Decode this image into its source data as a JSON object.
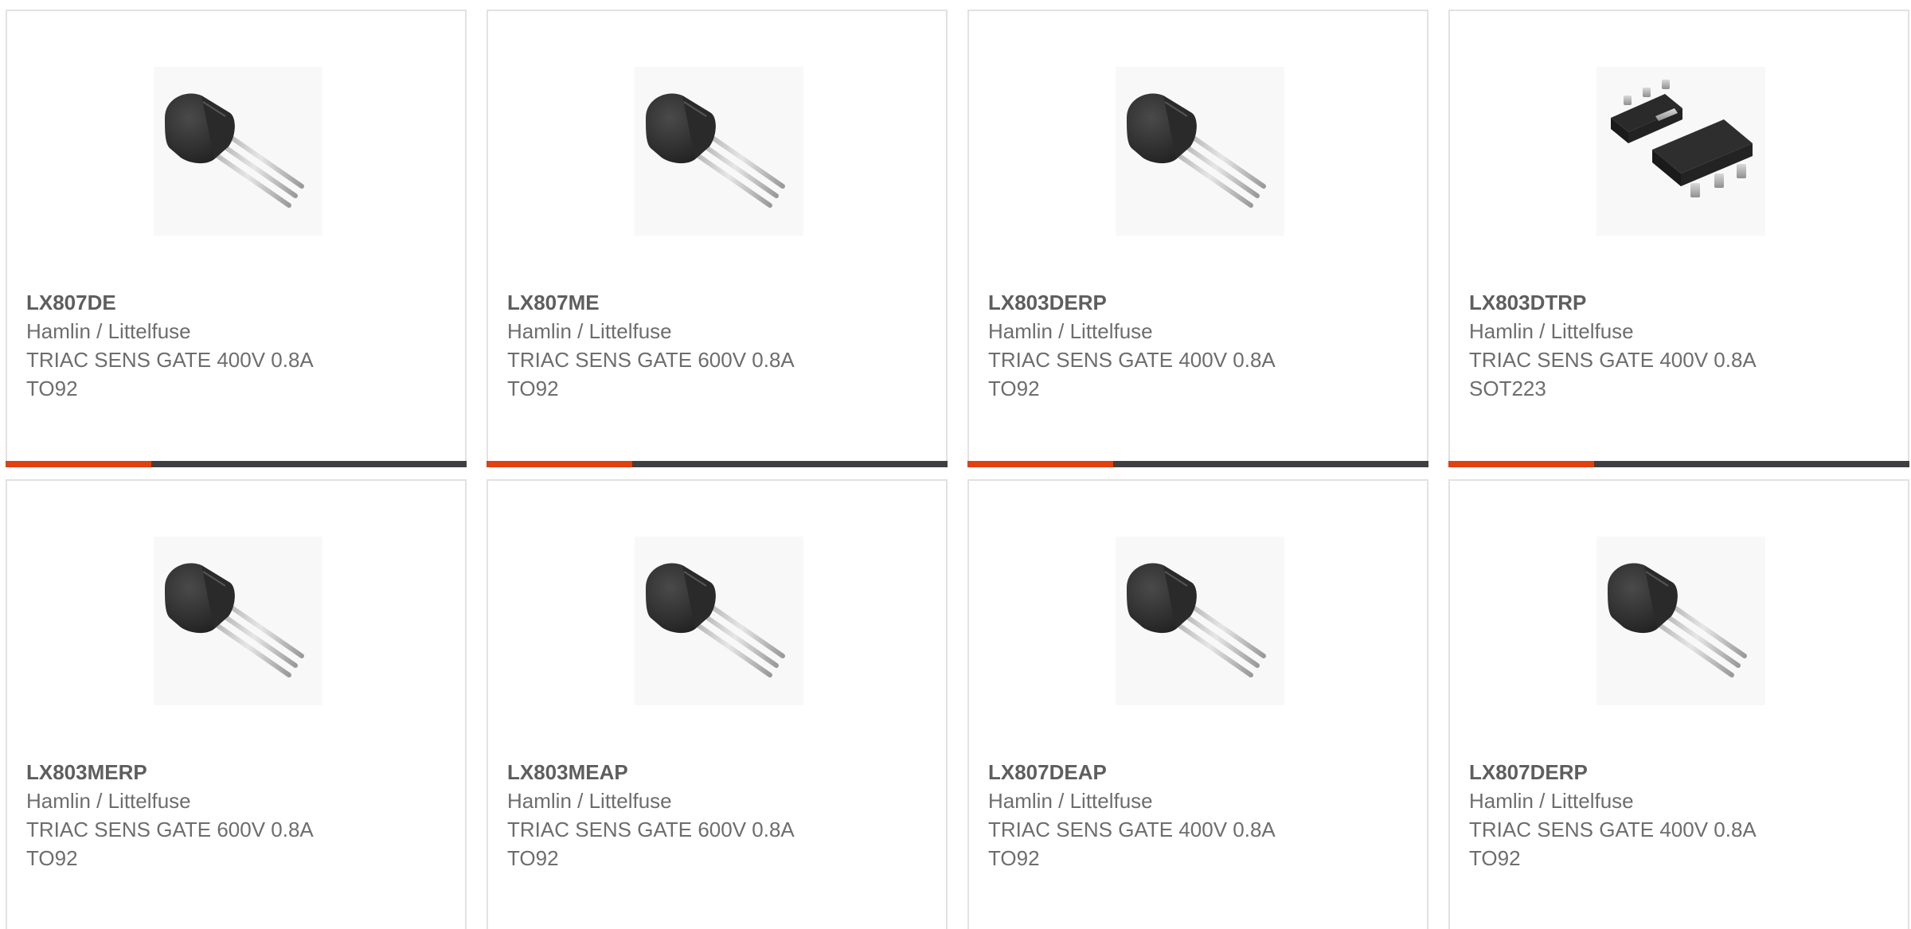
{
  "colors": {
    "accent": "#e2400e",
    "bar": "#3d3f43",
    "border": "#e2e2e2",
    "text": "#6d6d6d"
  },
  "cards": [
    {
      "part": "LX807DE",
      "mfr": "Hamlin / Littelfuse",
      "desc": "TRIAC SENS GATE 400V 0.8A",
      "pkg": "TO92",
      "image": "to92-package-icon"
    },
    {
      "part": "LX807ME",
      "mfr": "Hamlin / Littelfuse",
      "desc": "TRIAC SENS GATE 600V 0.8A",
      "pkg": "TO92",
      "image": "to92-package-icon"
    },
    {
      "part": "LX803DERP",
      "mfr": "Hamlin / Littelfuse",
      "desc": "TRIAC SENS GATE 400V 0.8A",
      "pkg": "TO92",
      "image": "to92-package-icon"
    },
    {
      "part": "LX803DTRP",
      "mfr": "Hamlin / Littelfuse",
      "desc": "TRIAC SENS GATE 400V 0.8A",
      "pkg": "SOT223",
      "image": "sot223-package-icon"
    },
    {
      "part": "LX803MERP",
      "mfr": "Hamlin / Littelfuse",
      "desc": "TRIAC SENS GATE 600V 0.8A",
      "pkg": "TO92",
      "image": "to92-package-icon"
    },
    {
      "part": "LX803MEAP",
      "mfr": "Hamlin / Littelfuse",
      "desc": "TRIAC SENS GATE 600V 0.8A",
      "pkg": "TO92",
      "image": "to92-package-icon"
    },
    {
      "part": "LX807DEAP",
      "mfr": "Hamlin / Littelfuse",
      "desc": "TRIAC SENS GATE 400V 0.8A",
      "pkg": "TO92",
      "image": "to92-package-icon"
    },
    {
      "part": "LX807DERP",
      "mfr": "Hamlin / Littelfuse",
      "desc": "TRIAC SENS GATE 400V 0.8A",
      "pkg": "TO92",
      "image": "to92-package-icon"
    }
  ]
}
